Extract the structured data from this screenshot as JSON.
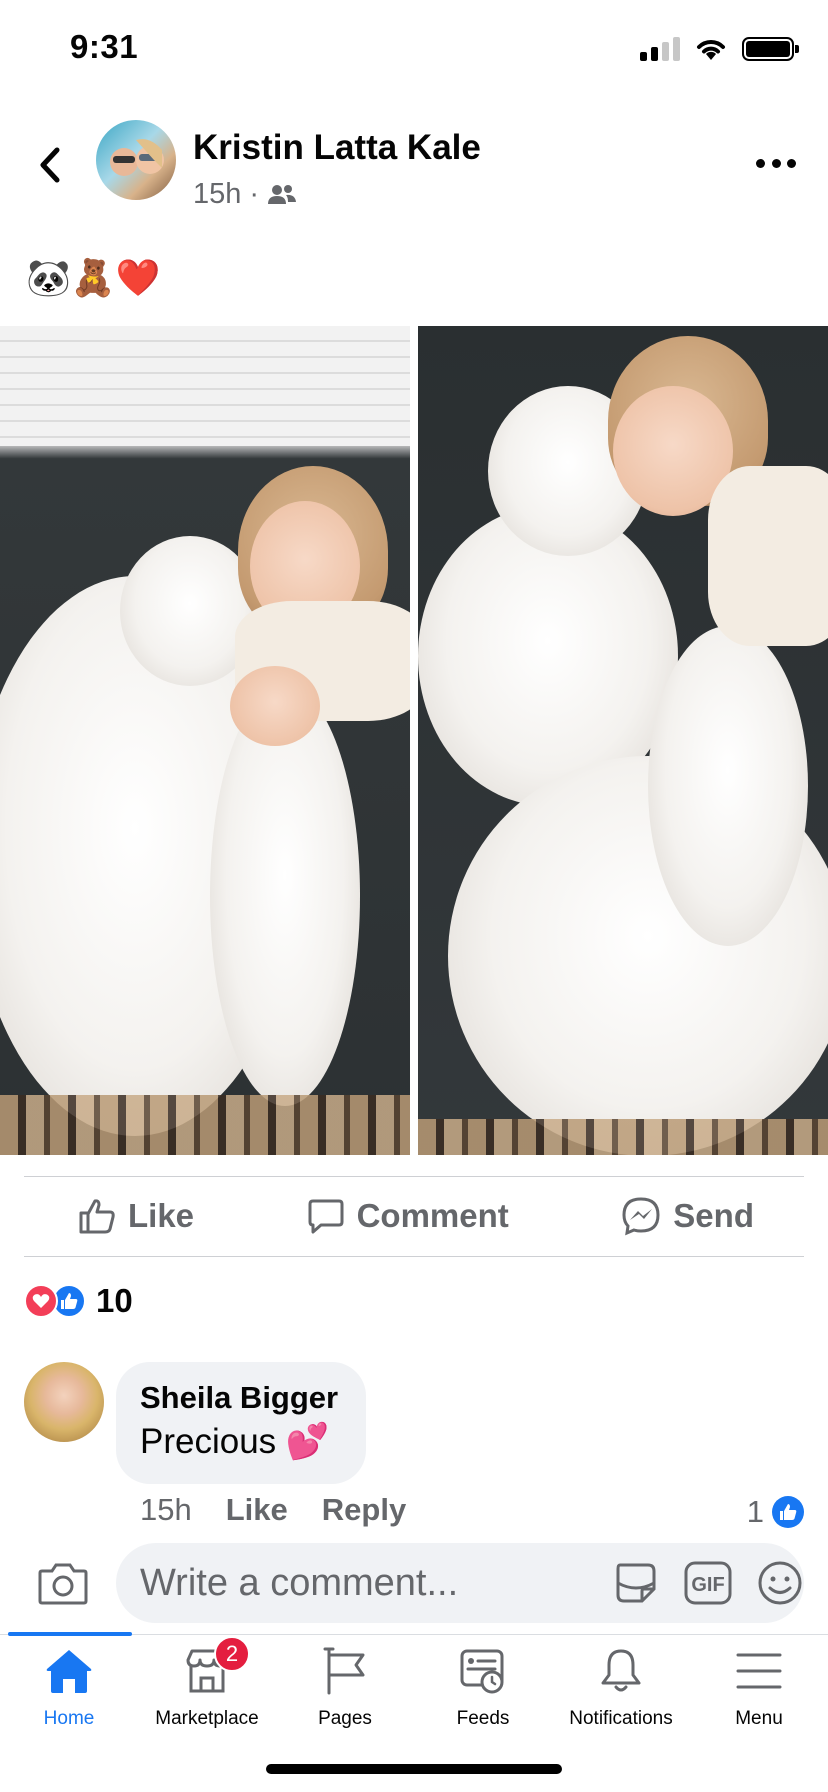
{
  "status_bar": {
    "time": "9:31"
  },
  "post": {
    "author": "Kristin Latta Kale",
    "time": "15h",
    "separator": "·",
    "audience_icon": "friends-icon",
    "text": "🐼🧸❤️",
    "photos": [
      {
        "description_icon": "photo-girl-kissing-dog"
      },
      {
        "description_icon": "photo-girl-hugging-dog"
      }
    ]
  },
  "actions": {
    "like": "Like",
    "comment": "Comment",
    "send": "Send"
  },
  "reactions": {
    "count": "10",
    "types": [
      "love",
      "like"
    ]
  },
  "comment": {
    "author": "Sheila Bigger",
    "text": "Precious 💕",
    "time": "15h",
    "like": "Like",
    "reply": "Reply",
    "like_count": "1"
  },
  "composer": {
    "placeholder": "Write a comment...",
    "gif": "GIF"
  },
  "nav": {
    "items": [
      {
        "label": "Home",
        "icon": "home-icon",
        "active": true
      },
      {
        "label": "Marketplace",
        "icon": "marketplace-icon",
        "badge": "2"
      },
      {
        "label": "Pages",
        "icon": "flag-icon"
      },
      {
        "label": "Feeds",
        "icon": "feeds-icon"
      },
      {
        "label": "Notifications",
        "icon": "bell-icon"
      },
      {
        "label": "Menu",
        "icon": "hamburger-icon"
      }
    ]
  },
  "colors": {
    "accent": "#1877f2",
    "secondary_text": "#65676b",
    "badge": "#e41e3f",
    "love": "#f33e58"
  }
}
